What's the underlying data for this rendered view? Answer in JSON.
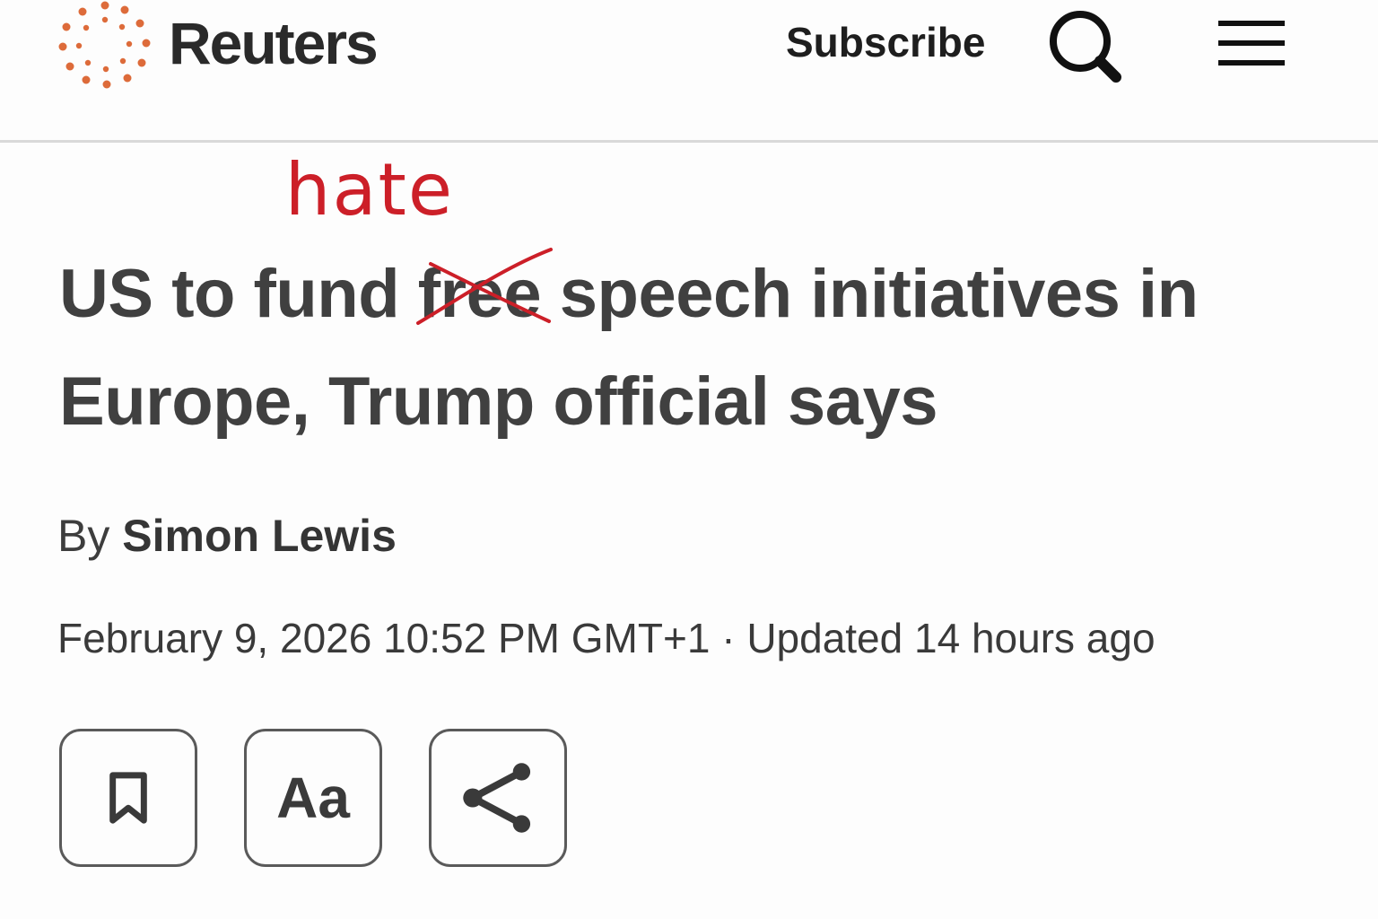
{
  "header": {
    "brand": "Reuters",
    "subscribe_label": "Subscribe",
    "icons": {
      "logo": "reuters-dot-ring-logo",
      "search": "search-icon",
      "menu": "hamburger-menu-icon"
    },
    "colors": {
      "logo": "#dd6b3a",
      "text": "#2a2a2a"
    }
  },
  "article": {
    "headline_start": "US to fund ",
    "struck_word": "free",
    "handwritten_word": "hate",
    "headline_end": " speech initiatives in Europe, Trump official says",
    "byline_prefix": "By",
    "author": "Simon Lewis",
    "published": "February 9, 2026 10:52 PM GMT+1",
    "separator": "·",
    "updated": "Updated 14 hours ago"
  },
  "annotation": {
    "color": "#cc1f28"
  },
  "actions": {
    "save_icon": "bookmark-icon",
    "font_size_label": "Aa",
    "share_icon": "share-icon"
  }
}
